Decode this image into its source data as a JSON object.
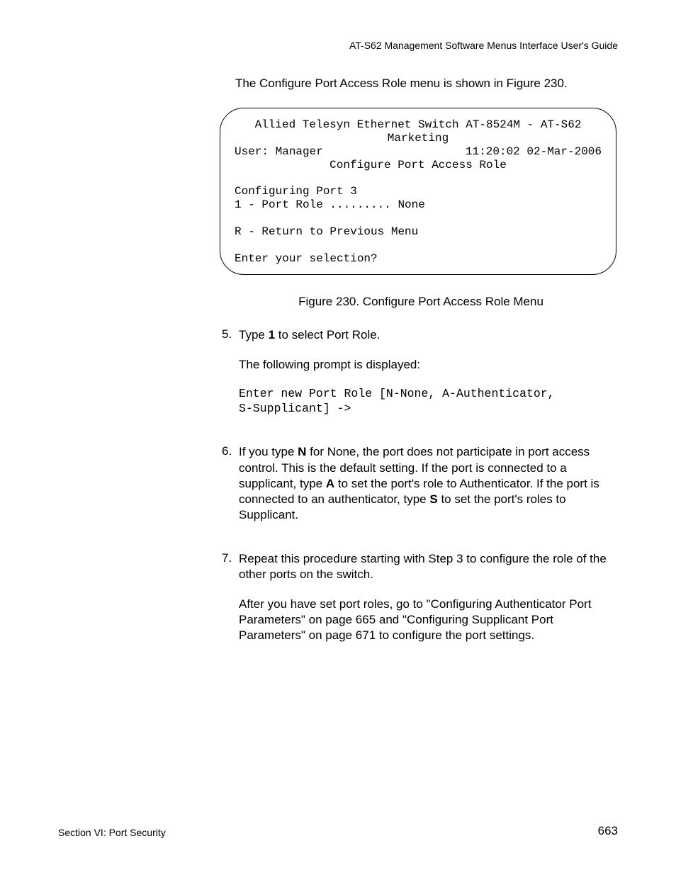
{
  "header": {
    "right": "AT-S62 Management Software Menus Interface User's Guide"
  },
  "intro": "The Configure Port Access Role menu is shown in Figure 230.",
  "terminal": {
    "line1": "Allied Telesyn Ethernet Switch AT-8524M - AT-S62",
    "line2": "Marketing",
    "user_label": "User: Manager",
    "timestamp": "11:20:02 02-Mar-2006",
    "title": "Configure Port Access Role",
    "config_line": "Configuring Port 3",
    "option1": "1 - Port Role ......... None",
    "return_line": "R - Return to Previous Menu",
    "prompt": "Enter your selection?"
  },
  "figcaption": "Figure 230. Configure Port Access Role Menu",
  "steps": {
    "s5": {
      "num": "5.",
      "line1a": "Type ",
      "line1b": "1",
      "line1c": " to select Port Role.",
      "para2": "The following prompt is displayed:",
      "code1": "Enter new Port Role [N-None, A-Authenticator,",
      "code2": "S-Supplicant] ->"
    },
    "s6": {
      "num": "6.",
      "t1": "If you type ",
      "b1": "N",
      "t2": " for None, the port does not participate in port access control. This is the default setting. If the port is connected to a supplicant, type ",
      "b2": "A",
      "t3": " to set the port's role to Authenticator. If the port is connected to an authenticator, type ",
      "b3": "S",
      "t4": " to set the port's roles to Supplicant."
    },
    "s7": {
      "num": "7.",
      "para1": "Repeat this procedure starting with Step 3 to configure the role of the other ports on the switch.",
      "para2": "After you have set port roles, go to \"Configuring Authenticator Port Parameters\" on page 665 and \"Configuring Supplicant Port Parameters\" on page 671 to configure the port settings."
    }
  },
  "footer": {
    "left": "Section VI: Port Security",
    "right": "663"
  }
}
